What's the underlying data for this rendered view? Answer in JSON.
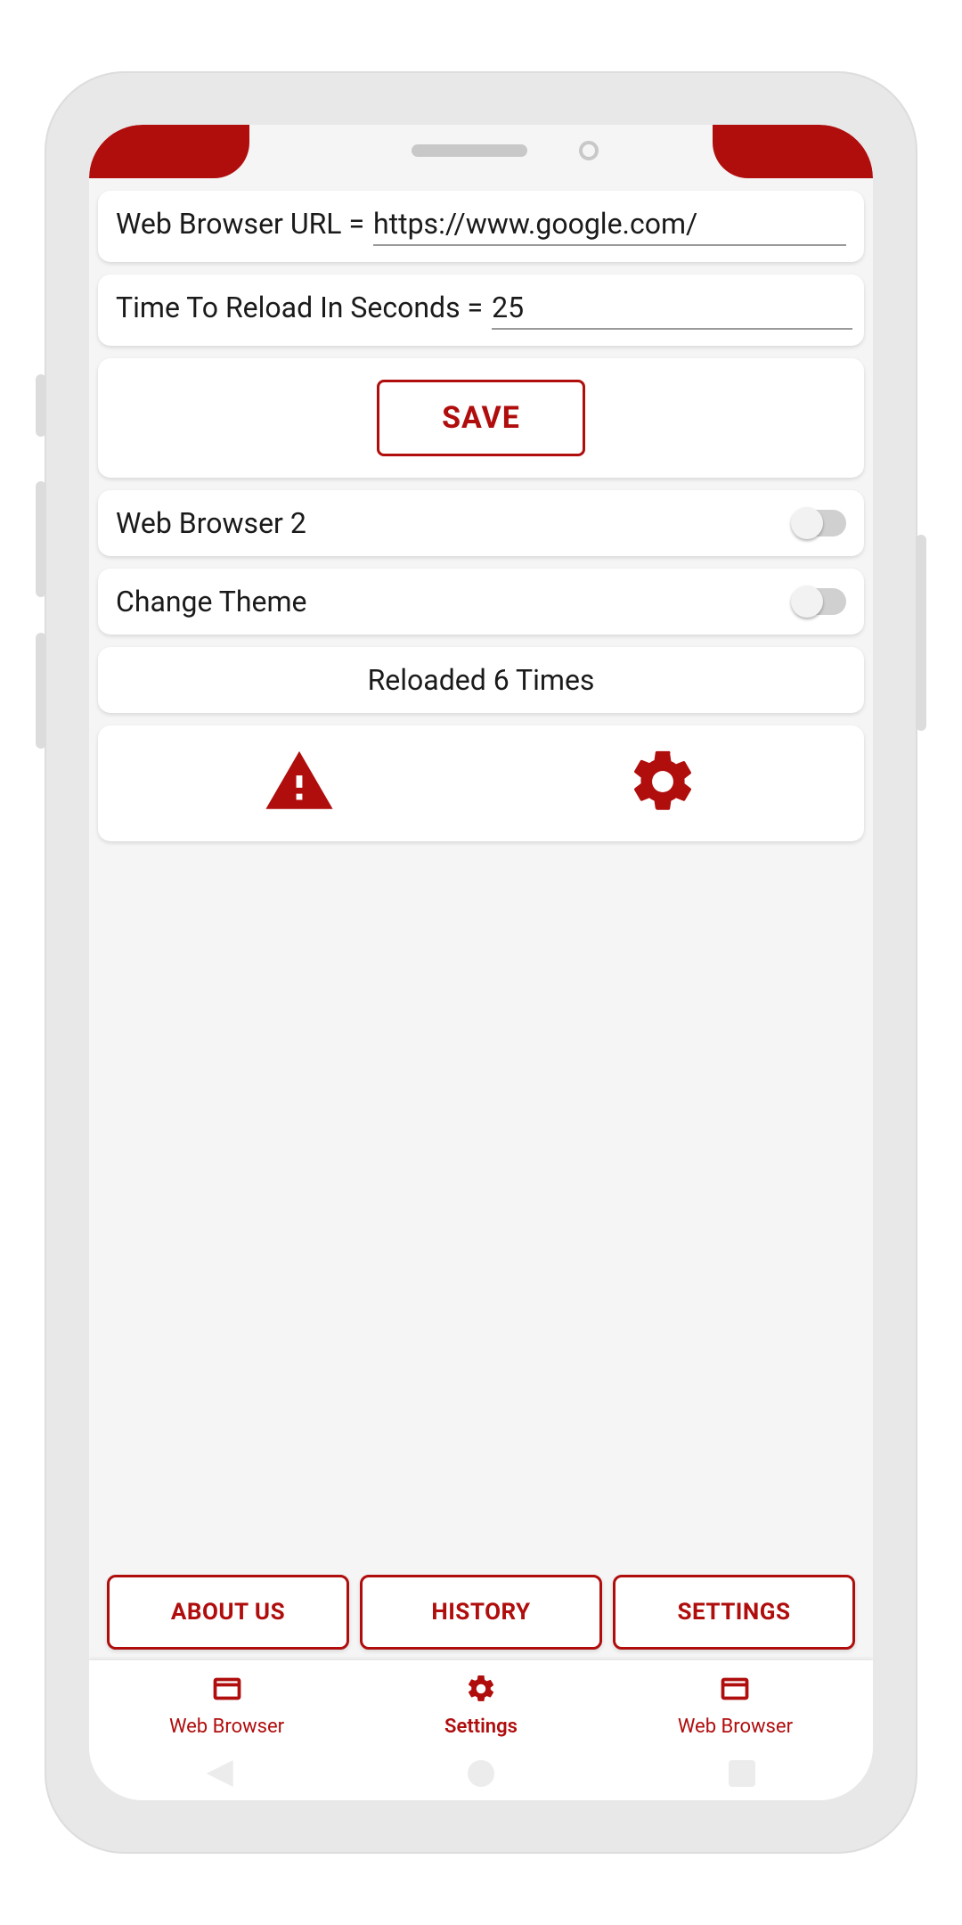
{
  "url_field": {
    "label": "Web Browser URL =",
    "value": "https://www.google.com/"
  },
  "time_field": {
    "label": "Time To Reload In Seconds =",
    "value": "25"
  },
  "save_button": "SAVE",
  "toggles": {
    "browser2": {
      "label": "Web Browser 2",
      "on": false
    },
    "theme": {
      "label": "Change Theme",
      "on": false
    }
  },
  "status": "Reloaded 6 Times",
  "bottom_buttons": {
    "about": "ABOUT US",
    "history": "HISTORY",
    "settings": "SETTINGS"
  },
  "nav": {
    "browser_left": "Web Browser",
    "settings": "Settings",
    "browser_right": "Web Browser"
  },
  "colors": {
    "accent": "#b00d0d"
  }
}
